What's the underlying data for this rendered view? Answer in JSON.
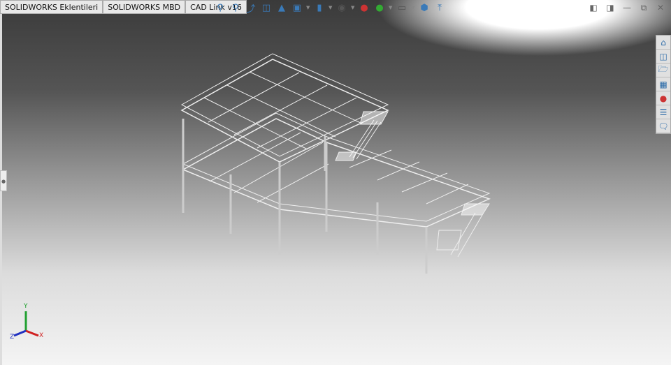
{
  "tabs": [
    {
      "label": "SOLIDWORKS Eklentileri"
    },
    {
      "label": "SOLIDWORKS MBD"
    },
    {
      "label": "CAD Link v16"
    }
  ],
  "view_toolbar": [
    "zoom-to-fit-icon",
    "zoom-to-area-icon",
    "previous-view-icon",
    "section-view-icon",
    "dynamic-annotation-icon",
    "view-orientation-icon",
    "display-style-icon",
    "hide-show-items-icon",
    "edit-appearance-icon",
    "apply-scene-icon",
    "view-settings-icon",
    "3d-view-icon",
    "normal-to-icon"
  ],
  "window_controls": [
    "tile-left-icon",
    "tile-right-icon",
    "minimize-icon",
    "restore-icon",
    "close-icon"
  ],
  "task_pane": [
    "home-icon",
    "design-library-icon",
    "file-explorer-icon",
    "view-palette-icon",
    "appearances-icon",
    "custom-properties-icon",
    "forum-icon"
  ],
  "triad": {
    "x": "X",
    "y": "Y",
    "z": "Z"
  },
  "colors": {
    "x_axis": "#d02020",
    "y_axis": "#20a030",
    "z_axis": "#2030c0"
  }
}
